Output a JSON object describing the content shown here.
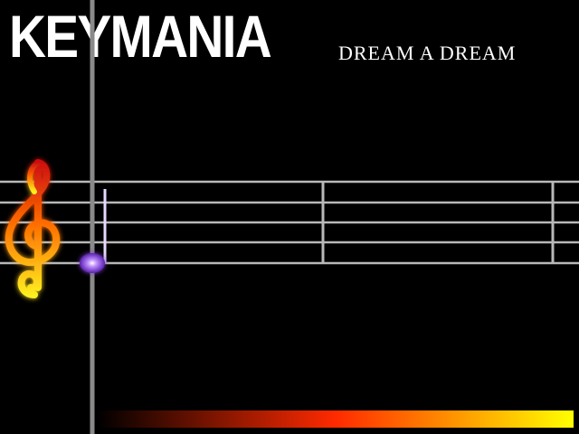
{
  "game": {
    "title": "KEYMANIA"
  },
  "song": {
    "title": "DREAM A DREAM"
  },
  "colors": {
    "background": "#000000",
    "staff_line": "#b8b8b8",
    "playhead": "#2a3cff",
    "note": "#a070e8",
    "clef_top": "#cc1010",
    "clef_bottom": "#ffee20",
    "bar_start": "#000000",
    "bar_mid": "#ff2a00",
    "bar_end": "#ffff00"
  },
  "icons": {
    "clef": "treble-clef-icon",
    "note": "eighth-note-icon"
  },
  "score_progress": 1.0
}
